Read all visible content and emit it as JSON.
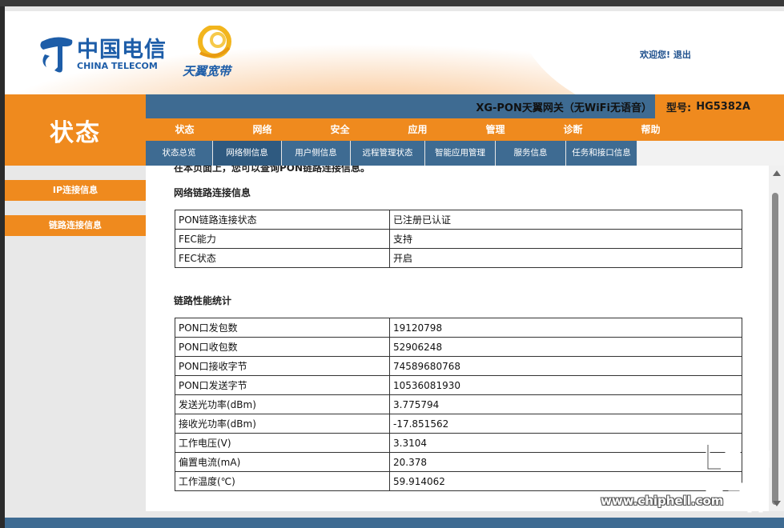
{
  "header": {
    "brand_cn": "中国电信",
    "brand_en": "CHINA TELECOM",
    "product_brand": "天翼宽带",
    "welcome": "欢迎您!",
    "logout": "退出"
  },
  "section_title": "状态",
  "gateway": {
    "name": "XG-PON天翼网关（无WiFi无语音）",
    "model_label": "型号:",
    "model_value": "HG5382A"
  },
  "main_nav": [
    "状态",
    "网络",
    "安全",
    "应用",
    "管理",
    "诊断",
    "帮助"
  ],
  "sub_nav": [
    "状态总览",
    "网络侧信息",
    "用户侧信息",
    "远程管理状态",
    "智能应用管理",
    "服务信息",
    "任务和接口信息"
  ],
  "side_menu": [
    "IP连接信息",
    "链路连接信息"
  ],
  "content": {
    "cut_line": "在本页面上，您可以查询PON链路连接信息。",
    "link_title": "网络链路连接信息",
    "link_rows": [
      {
        "key": "PON链路连接状态",
        "value": "已注册已认证"
      },
      {
        "key": "FEC能力",
        "value": "支持"
      },
      {
        "key": "FEC状态",
        "value": "开启"
      }
    ],
    "perf_title": "链路性能统计",
    "perf_rows": [
      {
        "key": "PON口发包数",
        "value": "19120798"
      },
      {
        "key": "PON口收包数",
        "value": "52906248"
      },
      {
        "key": "PON口接收字节",
        "value": "74589680768"
      },
      {
        "key": "PON口发送字节",
        "value": "10536081930"
      },
      {
        "key": "发送光功率(dBm)",
        "value": "3.775794"
      },
      {
        "key": "接收光功率(dBm)",
        "value": "-17.851562"
      },
      {
        "key": "工作电压(V)",
        "value": "3.3104"
      },
      {
        "key": "偏置电流(mA)",
        "value": "20.378"
      },
      {
        "key": "工作温度(℃)",
        "value": "59.914062"
      }
    ]
  },
  "watermark": {
    "site": "www.chiphell.com"
  },
  "colors": {
    "orange": "#ef8a1e",
    "blue": "#3e6b92",
    "brand_blue": "#1d5da8"
  }
}
